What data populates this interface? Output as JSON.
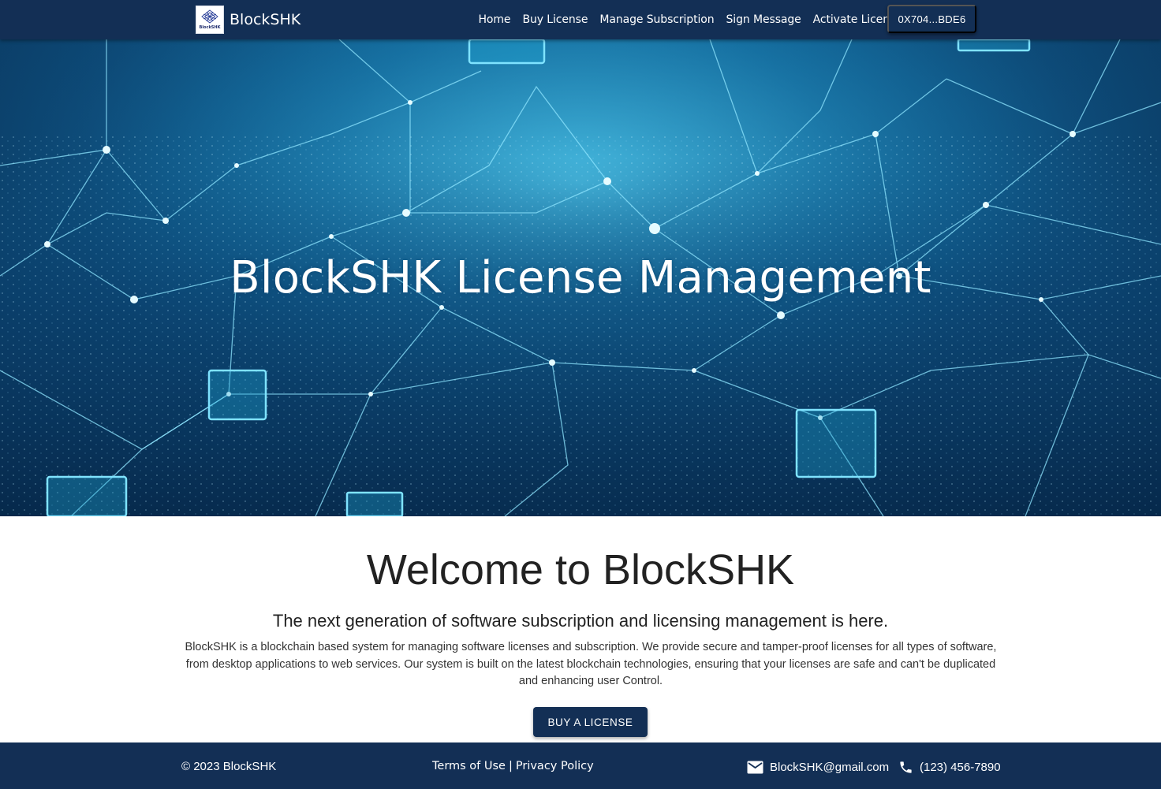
{
  "navbar": {
    "brand_name": "BlockSHK",
    "logo_text": "BlockSHK",
    "links": [
      "Home",
      "Buy License",
      "Manage Subscription",
      "Sign Message",
      "Activate License"
    ],
    "wallet_address": "0X704...BDE6",
    "color": "#132f55"
  },
  "hero": {
    "title": "BlockSHK License Management"
  },
  "main": {
    "heading": "Welcome to BlockSHK",
    "tagline": "The next generation of software subscription and licensing management is here.",
    "description": "BlockSHK is a blockchain based system for managing software licenses and subscription. We provide secure and tamper-proof licenses for all types of software, from desktop applications to web services. Our system is built on the latest blockchain technologies, ensuring that your licenses are safe and can't be duplicated and enhancing user Control.",
    "cta_label": "BUY A LICENSE"
  },
  "footer": {
    "copyright": "© 2023 BlockSHK",
    "terms_label": "Terms of Use",
    "separator": "|",
    "privacy_label": "Privacy Policy",
    "email_icon": "email-icon",
    "email": "BlockSHK@gmail.com",
    "phone_icon": "phone-icon",
    "phone": "(123) 456-7890"
  }
}
